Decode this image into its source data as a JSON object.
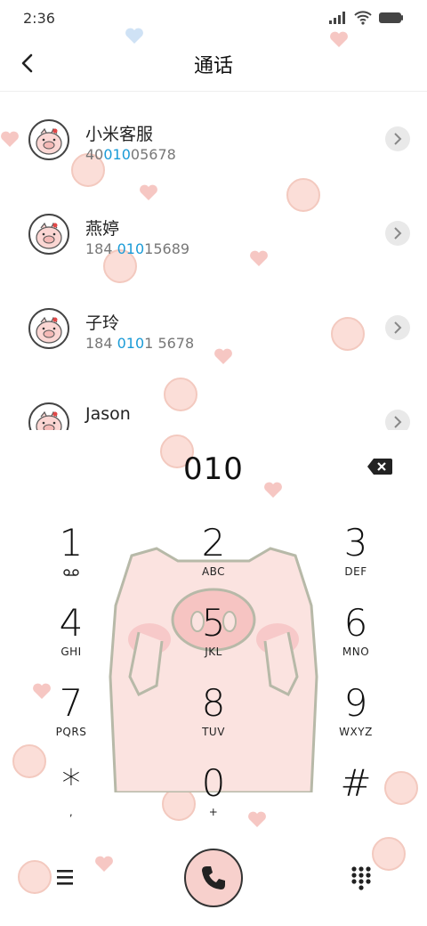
{
  "status_bar": {
    "time": "2:36"
  },
  "header": {
    "title": "通话",
    "back_icon": "chevron-left-icon"
  },
  "contacts": [
    {
      "name": "小米客服",
      "number_pre": "40",
      "number_hl": "010",
      "number_post": "05678"
    },
    {
      "name": "燕婷",
      "number_pre": "184 ",
      "number_hl": "010",
      "number_post": "15689"
    },
    {
      "name": "子玲",
      "number_pre": "184 ",
      "number_hl": "010",
      "number_post": "1 5678"
    },
    {
      "name": "Jason",
      "number_pre": "",
      "number_hl": "",
      "number_post": ""
    }
  ],
  "dialpad": {
    "entered": "010",
    "keys": [
      {
        "digit": "1",
        "letters": ""
      },
      {
        "digit": "2",
        "letters": "ABC"
      },
      {
        "digit": "3",
        "letters": "DEF"
      },
      {
        "digit": "4",
        "letters": "GHI"
      },
      {
        "digit": "5",
        "letters": "JKL"
      },
      {
        "digit": "6",
        "letters": "MNO"
      },
      {
        "digit": "7",
        "letters": "PQRS"
      },
      {
        "digit": "8",
        "letters": "TUV"
      },
      {
        "digit": "9",
        "letters": "WXYZ"
      },
      {
        "digit": "*",
        "letters": ","
      },
      {
        "digit": "0",
        "letters": "+"
      },
      {
        "digit": "#",
        "letters": ""
      }
    ]
  },
  "colors": {
    "highlight": "#1a9bd7",
    "call_button": "#f7d0cc",
    "accent_pink": "#f4b7b1"
  }
}
